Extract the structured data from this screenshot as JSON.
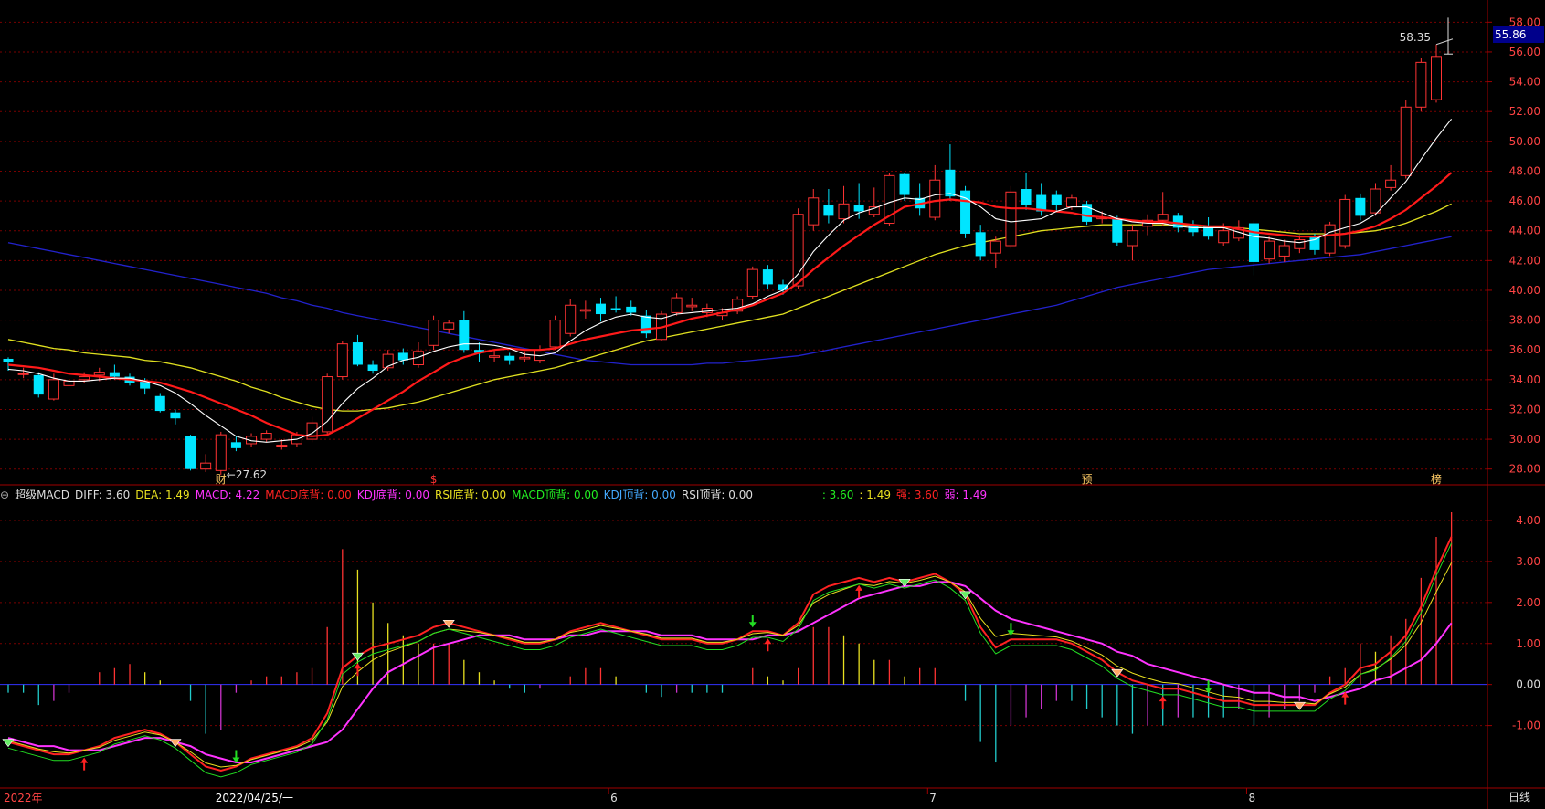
{
  "colors": {
    "up": "#ff3333",
    "down": "#00e5ff",
    "ma5": "#ffffff",
    "ma10": "#ff1a1a",
    "ma20": "#e0e020",
    "ma60": "#2222cc",
    "diff": "#ff2222",
    "dea": "#ff33ff",
    "grid": "#7a0000",
    "axis": "#a00000"
  },
  "indicator": {
    "name": "超级MACD",
    "diff_label": "DIFF: 3.60",
    "dea_label": "DEA: 1.49",
    "macd_label": "MACD: 4.22",
    "macd_bottom": "MACD底背: 0.00",
    "kdj_bottom": "KDJ底背: 0.00",
    "rsi_bottom": "RSI底背: 0.00",
    "macd_top": "MACD顶背: 0.00",
    "kdj_top": "KDJ顶背: 0.00",
    "rsi_top": "RSI顶背: 0.00",
    "v1": ": 3.60",
    "v2": ": 1.49",
    "strong": "强: 3.60",
    "weak": "弱: 1.49"
  },
  "current_price": "55.86",
  "period_label": "日线",
  "chart_data": {
    "type": "candlestick",
    "price_axis": {
      "min": 27,
      "max": 59,
      "ticks": [
        58.0,
        56.0,
        54.0,
        52.0,
        50.0,
        48.0,
        46.0,
        44.0,
        42.0,
        40.0,
        38.0,
        36.0,
        34.0,
        32.0,
        30.0,
        28.0
      ]
    },
    "macd_axis": {
      "min": -2.5,
      "max": 4.4,
      "ticks": [
        4.0,
        3.0,
        2.0,
        1.0,
        0.0,
        -1.0
      ]
    },
    "annotations": {
      "high": "58.35",
      "low": "27.62"
    },
    "x_labels": [
      "2022年",
      "2022/04/25/一",
      "6",
      "7",
      "8"
    ],
    "event_markers": [
      "财",
      "$",
      "预",
      "榜"
    ],
    "candles": [
      [
        35.4,
        35.2,
        35.5,
        34.6
      ],
      [
        34.4,
        34.4,
        34.8,
        34.1
      ],
      [
        34.3,
        33.0,
        34.5,
        32.8
      ],
      [
        32.7,
        34.0,
        34.4,
        32.6
      ],
      [
        33.6,
        33.9,
        34.3,
        33.4
      ],
      [
        34.0,
        34.2,
        34.5,
        33.8
      ],
      [
        34.3,
        34.5,
        34.8,
        33.9
      ],
      [
        34.5,
        34.2,
        35.0,
        34.0
      ],
      [
        34.2,
        33.8,
        34.4,
        33.6
      ],
      [
        33.9,
        33.4,
        34.1,
        33.0
      ],
      [
        32.9,
        31.9,
        33.1,
        31.8
      ],
      [
        31.8,
        31.4,
        32.0,
        31.0
      ],
      [
        30.2,
        28.0,
        30.3,
        27.9
      ],
      [
        28.0,
        28.4,
        29.0,
        27.8
      ],
      [
        27.9,
        30.3,
        30.5,
        27.6
      ],
      [
        29.8,
        29.4,
        30.2,
        29.2
      ],
      [
        29.7,
        30.2,
        30.4,
        29.5
      ],
      [
        30.0,
        30.4,
        30.6,
        29.8
      ],
      [
        29.6,
        29.6,
        30.0,
        29.3
      ],
      [
        29.7,
        30.3,
        30.5,
        29.5
      ],
      [
        30.0,
        31.1,
        31.5,
        29.8
      ],
      [
        30.5,
        34.2,
        34.4,
        30.3
      ],
      [
        34.2,
        36.4,
        36.6,
        34.0
      ],
      [
        36.5,
        35.0,
        37.0,
        34.9
      ],
      [
        35.0,
        34.6,
        35.3,
        34.4
      ],
      [
        34.8,
        35.7,
        36.0,
        34.6
      ],
      [
        35.8,
        35.3,
        36.1,
        35.0
      ],
      [
        35.0,
        35.9,
        36.5,
        34.8
      ],
      [
        36.3,
        38.0,
        38.3,
        36.0
      ],
      [
        37.4,
        37.8,
        38.0,
        37.1
      ],
      [
        38.0,
        36.0,
        38.6,
        35.8
      ],
      [
        36.0,
        35.8,
        36.5,
        35.2
      ],
      [
        35.5,
        35.6,
        36.0,
        35.2
      ],
      [
        35.6,
        35.3,
        35.8,
        35.0
      ],
      [
        35.4,
        35.5,
        35.9,
        35.2
      ],
      [
        35.3,
        36.0,
        36.3,
        35.1
      ],
      [
        36.2,
        38.0,
        38.3,
        36.0
      ],
      [
        37.1,
        39.0,
        39.4,
        36.9
      ],
      [
        38.6,
        38.7,
        39.3,
        38.1
      ],
      [
        39.1,
        38.4,
        39.5,
        37.9
      ],
      [
        38.8,
        38.7,
        39.6,
        38.5
      ],
      [
        38.9,
        38.5,
        39.3,
        38.3
      ],
      [
        38.3,
        37.1,
        38.7,
        36.8
      ],
      [
        36.7,
        38.4,
        38.6,
        36.6
      ],
      [
        38.5,
        39.5,
        39.8,
        38.3
      ],
      [
        38.9,
        39.0,
        39.5,
        38.6
      ],
      [
        38.5,
        38.8,
        39.1,
        38.2
      ],
      [
        38.3,
        38.5,
        38.8,
        38.0
      ],
      [
        38.6,
        39.4,
        39.6,
        38.4
      ],
      [
        39.6,
        41.4,
        41.6,
        39.4
      ],
      [
        41.4,
        40.4,
        41.7,
        40.1
      ],
      [
        40.4,
        40.0,
        40.7,
        39.7
      ],
      [
        40.3,
        45.1,
        45.5,
        40.1
      ],
      [
        44.4,
        46.2,
        46.8,
        44.0
      ],
      [
        45.7,
        45.0,
        46.8,
        44.5
      ],
      [
        44.8,
        45.8,
        47.0,
        44.5
      ],
      [
        45.7,
        45.3,
        47.2,
        44.8
      ],
      [
        45.1,
        45.6,
        46.9,
        44.9
      ],
      [
        44.5,
        47.7,
        47.9,
        44.3
      ],
      [
        47.8,
        46.4,
        47.9,
        46.0
      ],
      [
        46.2,
        45.5,
        47.2,
        45.0
      ],
      [
        44.9,
        47.4,
        48.4,
        44.7
      ],
      [
        48.1,
        46.3,
        49.8,
        46.0
      ],
      [
        46.7,
        43.8,
        47.0,
        43.5
      ],
      [
        43.9,
        42.3,
        44.4,
        42.0
      ],
      [
        42.5,
        43.3,
        43.6,
        41.5
      ],
      [
        43.0,
        46.6,
        47.0,
        42.8
      ],
      [
        46.8,
        45.7,
        47.9,
        45.4
      ],
      [
        46.4,
        45.3,
        47.2,
        45.0
      ],
      [
        46.4,
        45.7,
        46.7,
        45.3
      ],
      [
        45.6,
        46.2,
        46.4,
        45.4
      ],
      [
        45.8,
        44.6,
        46.0,
        44.4
      ],
      [
        44.8,
        44.9,
        45.3,
        44.5
      ],
      [
        44.8,
        43.2,
        45.0,
        43.0
      ],
      [
        43.0,
        44.0,
        44.4,
        42.0
      ],
      [
        44.3,
        44.7,
        45.1,
        43.7
      ],
      [
        44.7,
        45.1,
        46.6,
        44.3
      ],
      [
        45.0,
        44.2,
        45.2,
        43.9
      ],
      [
        44.4,
        43.9,
        44.7,
        43.6
      ],
      [
        44.3,
        43.6,
        44.9,
        43.4
      ],
      [
        43.2,
        44.0,
        44.5,
        43.0
      ],
      [
        43.5,
        44.2,
        44.7,
        43.3
      ],
      [
        44.5,
        41.9,
        44.7,
        41.0
      ],
      [
        42.1,
        43.3,
        43.6,
        41.8
      ],
      [
        42.3,
        43.0,
        43.4,
        41.9
      ],
      [
        42.8,
        43.4,
        43.7,
        42.5
      ],
      [
        43.6,
        42.7,
        43.8,
        42.4
      ],
      [
        42.5,
        44.4,
        44.6,
        42.3
      ],
      [
        43.0,
        46.1,
        46.4,
        42.8
      ],
      [
        46.2,
        45.0,
        46.5,
        44.7
      ],
      [
        45.2,
        46.8,
        47.2,
        45.0
      ],
      [
        46.9,
        47.4,
        48.4,
        46.7
      ],
      [
        47.7,
        52.3,
        52.8,
        47.5
      ],
      [
        52.3,
        55.3,
        55.6,
        52.0
      ],
      [
        52.8,
        55.7,
        56.5,
        52.6
      ]
    ],
    "series": [
      {
        "name": "MA5",
        "values": [
          34.7,
          34.6,
          34.4,
          34.1,
          33.9,
          33.9,
          34.0,
          34.1,
          34.1,
          33.9,
          33.6,
          33.1,
          32.4,
          31.6,
          30.9,
          30.2,
          29.9,
          29.8,
          29.9,
          30.0,
          30.4,
          31.2,
          32.4,
          33.4,
          34.1,
          34.9,
          35.3,
          35.5,
          35.9,
          36.2,
          36.4,
          36.4,
          36.3,
          36.1,
          35.7,
          35.6,
          35.8,
          36.6,
          37.3,
          37.8,
          38.2,
          38.4,
          38.2,
          38.1,
          38.4,
          38.5,
          38.6,
          38.7,
          38.8,
          39.1,
          39.6,
          40.0,
          41.1,
          42.6,
          43.7,
          44.7,
          45.2,
          45.5,
          45.9,
          46.2,
          46.1,
          46.4,
          46.5,
          46.2,
          45.6,
          44.8,
          44.6,
          44.7,
          44.8,
          45.3,
          45.6,
          45.6,
          45.2,
          44.8,
          44.6,
          44.5,
          44.5,
          44.3,
          44.2,
          44.2,
          44.2,
          43.9,
          43.6,
          43.5,
          43.3,
          43.2,
          43.4,
          43.9,
          44.2,
          44.5,
          45.1,
          46.2,
          47.3,
          48.8,
          50.2,
          51.5
        ]
      },
      {
        "name": "MA10",
        "values": [
          35.0,
          34.9,
          34.8,
          34.6,
          34.4,
          34.3,
          34.2,
          34.1,
          34.0,
          33.9,
          33.8,
          33.5,
          33.2,
          32.8,
          32.4,
          32.0,
          31.6,
          31.1,
          30.7,
          30.3,
          30.2,
          30.3,
          30.8,
          31.4,
          32.0,
          32.6,
          33.2,
          33.9,
          34.5,
          35.1,
          35.5,
          35.8,
          36.0,
          36.1,
          36.0,
          36.0,
          36.1,
          36.4,
          36.7,
          36.9,
          37.1,
          37.3,
          37.4,
          37.5,
          37.8,
          38.1,
          38.3,
          38.5,
          38.7,
          39.0,
          39.4,
          39.8,
          40.5,
          41.4,
          42.2,
          43.0,
          43.7,
          44.4,
          45.0,
          45.6,
          45.8,
          46.0,
          46.1,
          46.0,
          45.9,
          45.6,
          45.5,
          45.5,
          45.4,
          45.3,
          45.2,
          45.0,
          44.9,
          44.8,
          44.7,
          44.6,
          44.6,
          44.5,
          44.4,
          44.3,
          44.3,
          44.1,
          43.9,
          43.8,
          43.7,
          43.6,
          43.6,
          43.7,
          43.8,
          44.0,
          44.3,
          44.8,
          45.4,
          46.2,
          47.0,
          47.9
        ]
      },
      {
        "name": "MA20",
        "values": [
          36.7,
          36.5,
          36.3,
          36.1,
          36.0,
          35.8,
          35.7,
          35.6,
          35.5,
          35.3,
          35.2,
          35.0,
          34.8,
          34.5,
          34.2,
          33.9,
          33.5,
          33.2,
          32.8,
          32.5,
          32.2,
          32.0,
          31.9,
          31.9,
          32.0,
          32.1,
          32.3,
          32.5,
          32.8,
          33.1,
          33.4,
          33.7,
          34.0,
          34.2,
          34.4,
          34.6,
          34.8,
          35.1,
          35.4,
          35.7,
          36.0,
          36.3,
          36.6,
          36.8,
          37.0,
          37.2,
          37.4,
          37.6,
          37.8,
          38.0,
          38.2,
          38.4,
          38.8,
          39.2,
          39.6,
          40.0,
          40.4,
          40.8,
          41.2,
          41.6,
          42.0,
          42.4,
          42.7,
          43.0,
          43.2,
          43.4,
          43.6,
          43.8,
          44.0,
          44.1,
          44.2,
          44.3,
          44.4,
          44.4,
          44.4,
          44.4,
          44.4,
          44.4,
          44.3,
          44.3,
          44.2,
          44.2,
          44.1,
          44.0,
          43.9,
          43.8,
          43.8,
          43.8,
          43.8,
          43.9,
          44.0,
          44.2,
          44.5,
          44.9,
          45.3,
          45.8
        ]
      },
      {
        "name": "MA60",
        "values": [
          43.2,
          43.0,
          42.8,
          42.6,
          42.4,
          42.2,
          42.0,
          41.8,
          41.6,
          41.4,
          41.2,
          41.0,
          40.8,
          40.6,
          40.4,
          40.2,
          40.0,
          39.8,
          39.5,
          39.3,
          39.0,
          38.8,
          38.5,
          38.3,
          38.1,
          37.9,
          37.7,
          37.5,
          37.3,
          37.1,
          36.9,
          36.7,
          36.5,
          36.3,
          36.1,
          35.9,
          35.7,
          35.5,
          35.3,
          35.2,
          35.1,
          35.0,
          35.0,
          35.0,
          35.0,
          35.0,
          35.1,
          35.1,
          35.2,
          35.3,
          35.4,
          35.5,
          35.6,
          35.8,
          36.0,
          36.2,
          36.4,
          36.6,
          36.8,
          37.0,
          37.2,
          37.4,
          37.6,
          37.8,
          38.0,
          38.2,
          38.4,
          38.6,
          38.8,
          39.0,
          39.3,
          39.6,
          39.9,
          40.2,
          40.4,
          40.6,
          40.8,
          41.0,
          41.2,
          41.4,
          41.5,
          41.6,
          41.7,
          41.8,
          41.9,
          42.0,
          42.1,
          42.2,
          42.3,
          42.4,
          42.6,
          42.8,
          43.0,
          43.2,
          43.4,
          43.6
        ]
      },
      {
        "name": "DIFF",
        "values": [
          -1.4,
          -1.5,
          -1.6,
          -1.7,
          -1.7,
          -1.6,
          -1.5,
          -1.3,
          -1.2,
          -1.1,
          -1.2,
          -1.4,
          -1.7,
          -2.0,
          -2.1,
          -2.0,
          -1.8,
          -1.7,
          -1.6,
          -1.5,
          -1.3,
          -0.7,
          0.4,
          0.7,
          0.9,
          1.0,
          1.1,
          1.2,
          1.4,
          1.5,
          1.4,
          1.3,
          1.2,
          1.1,
          1.0,
          1.0,
          1.1,
          1.3,
          1.4,
          1.5,
          1.4,
          1.3,
          1.2,
          1.1,
          1.1,
          1.1,
          1.0,
          1.0,
          1.1,
          1.3,
          1.3,
          1.2,
          1.5,
          2.2,
          2.4,
          2.5,
          2.6,
          2.5,
          2.6,
          2.5,
          2.6,
          2.7,
          2.5,
          2.2,
          1.4,
          0.9,
          1.1,
          1.1,
          1.1,
          1.1,
          1.0,
          0.8,
          0.6,
          0.3,
          0.1,
          0.0,
          -0.1,
          -0.1,
          -0.2,
          -0.3,
          -0.4,
          -0.4,
          -0.5,
          -0.5,
          -0.5,
          -0.5,
          -0.5,
          -0.2,
          0.0,
          0.4,
          0.5,
          0.8,
          1.2,
          1.9,
          2.8,
          3.6
        ]
      },
      {
        "name": "DEA",
        "values": [
          -1.3,
          -1.4,
          -1.5,
          -1.5,
          -1.6,
          -1.6,
          -1.6,
          -1.5,
          -1.4,
          -1.3,
          -1.3,
          -1.4,
          -1.5,
          -1.7,
          -1.8,
          -1.9,
          -1.9,
          -1.8,
          -1.7,
          -1.6,
          -1.5,
          -1.4,
          -1.1,
          -0.6,
          -0.1,
          0.3,
          0.5,
          0.7,
          0.9,
          1.0,
          1.1,
          1.2,
          1.2,
          1.2,
          1.1,
          1.1,
          1.1,
          1.2,
          1.2,
          1.3,
          1.3,
          1.3,
          1.3,
          1.2,
          1.2,
          1.2,
          1.1,
          1.1,
          1.1,
          1.1,
          1.2,
          1.2,
          1.3,
          1.5,
          1.7,
          1.9,
          2.1,
          2.2,
          2.3,
          2.4,
          2.4,
          2.5,
          2.5,
          2.4,
          2.1,
          1.8,
          1.6,
          1.5,
          1.4,
          1.3,
          1.2,
          1.1,
          1.0,
          0.8,
          0.7,
          0.5,
          0.4,
          0.3,
          0.2,
          0.1,
          0.0,
          -0.1,
          -0.2,
          -0.2,
          -0.3,
          -0.3,
          -0.4,
          -0.3,
          -0.2,
          -0.1,
          0.1,
          0.2,
          0.4,
          0.6,
          1.0,
          1.5
        ]
      }
    ],
    "macd_hist": [
      -0.2,
      -0.2,
      -0.5,
      -0.4,
      -0.2,
      0.0,
      0.3,
      0.4,
      0.5,
      0.3,
      0.1,
      0.0,
      -0.4,
      -1.2,
      -1.1,
      -0.2,
      0.1,
      0.2,
      0.2,
      0.3,
      0.4,
      1.4,
      3.3,
      2.8,
      2.0,
      1.5,
      1.2,
      1.0,
      1.0,
      1.0,
      0.6,
      0.3,
      0.1,
      -0.1,
      -0.2,
      -0.1,
      0.0,
      0.2,
      0.4,
      0.4,
      0.2,
      0.0,
      -0.2,
      -0.3,
      -0.2,
      -0.2,
      -0.2,
      -0.2,
      0.0,
      0.4,
      0.2,
      0.1,
      0.4,
      1.4,
      1.4,
      1.2,
      1.0,
      0.6,
      0.6,
      0.2,
      0.4,
      0.4,
      0.0,
      -0.4,
      -1.4,
      -1.9,
      -1.0,
      -0.8,
      -0.6,
      -0.4,
      -0.4,
      -0.6,
      -0.8,
      -1.0,
      -1.2,
      -1.0,
      -1.0,
      -0.8,
      -0.8,
      -0.8,
      -0.8,
      -0.6,
      -1.0,
      -0.8,
      -0.6,
      -0.4,
      -0.2,
      0.2,
      0.4,
      1.0,
      0.8,
      1.2,
      1.6,
      2.6,
      3.6,
      4.2
    ]
  }
}
